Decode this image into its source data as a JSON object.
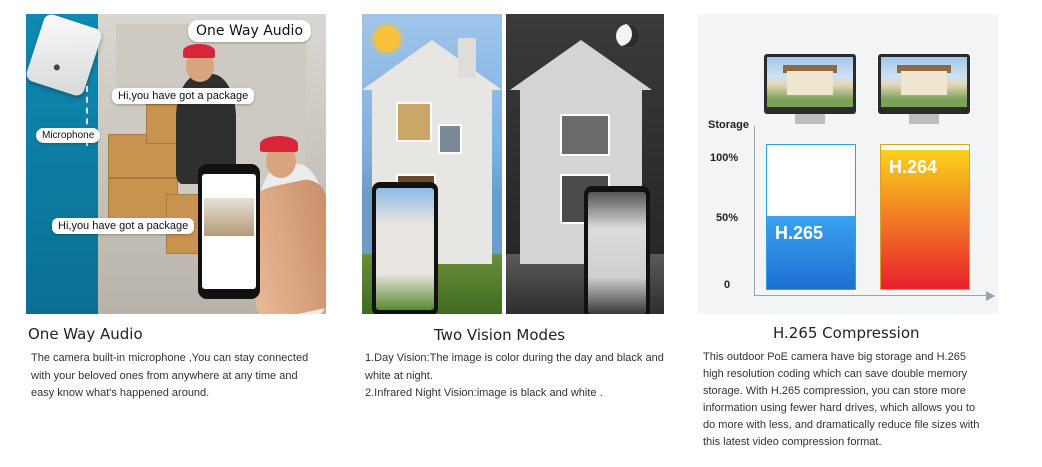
{
  "sections": [
    {
      "title": "One Way Audio",
      "description": "The camera  built-in microphone ,You can stay connected with your beloved ones from anywhere at any time and easy know what's happened around.",
      "image": {
        "top_bubble": "One Way Audio",
        "bubble_upper": "Hi,you have got a package",
        "bubble_lower": "Hi,you have got a package",
        "mic_label": "Microphone"
      }
    },
    {
      "title": "Two Vision Modes",
      "lines": [
        {
          "label": "1.Day Vision:",
          "text": "The image is color during the day and black and white at night."
        },
        {
          "label": "2.Infrared Night Vision:",
          "text": "image is black and white ."
        }
      ],
      "icons": [
        "sun-icon",
        "moon-icon"
      ]
    },
    {
      "title": "H.265 Compression",
      "description": "This outdoor PoE camera have big storage and H.265 high resolution coding which can save double memory storage. With H.265 compression, you can store more information using fewer hard drives, which allows you to do more with less, and dramatically reduce file sizes with this latest video compression format.",
      "chart": {
        "ylabel": "Storage",
        "ticks": [
          "100%",
          "50%",
          "0"
        ],
        "bars": [
          {
            "name": "H.265",
            "value": 50,
            "color_top": "#3aa3ef",
            "color_bottom": "#1f6fd0"
          },
          {
            "name": "H.264",
            "value": 95,
            "color_top": "#f9d31a",
            "color_bottom": "#e8202d"
          }
        ]
      }
    }
  ]
}
